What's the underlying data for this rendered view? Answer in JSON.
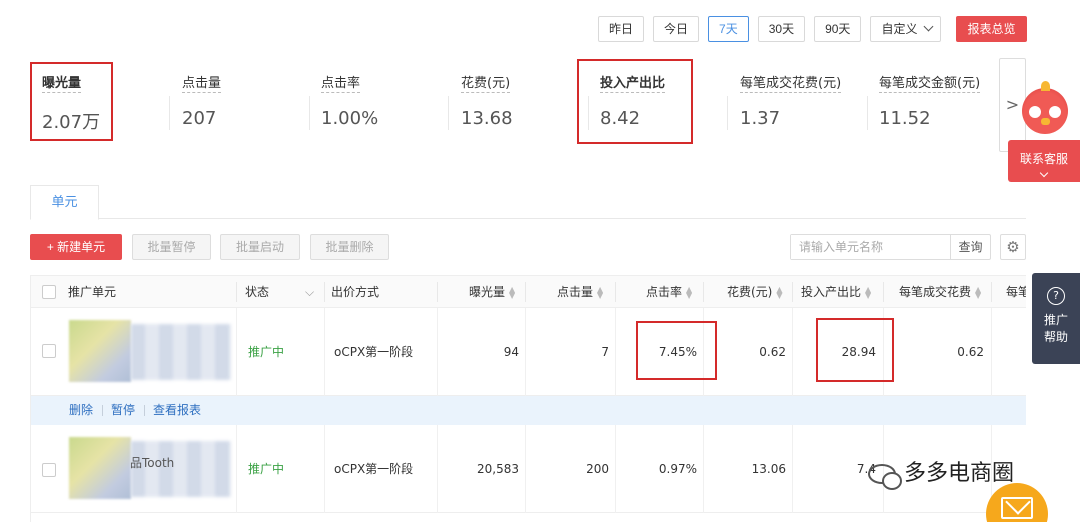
{
  "date_range": {
    "buttons": [
      "昨日",
      "今日",
      "7天",
      "30天",
      "90天"
    ],
    "active": "7天",
    "custom_label": "自定义",
    "summary_button": "报表总览"
  },
  "metrics": [
    {
      "label": "曝光量",
      "value": "2.07万"
    },
    {
      "label": "点击量",
      "value": "207"
    },
    {
      "label": "点击率",
      "value": "1.00%"
    },
    {
      "label": "花费(元)",
      "value": "13.68"
    },
    {
      "label": "投入产出比",
      "value": "8.42"
    },
    {
      "label": "每笔成交花费(元)",
      "value": "1.37"
    },
    {
      "label": "每笔成交金额(元)",
      "value": "11.52"
    }
  ],
  "metrics_next": ">",
  "service": {
    "label": "联系客服"
  },
  "tabs": [
    {
      "label": "单元"
    }
  ],
  "toolbar": {
    "new_unit": "+ 新建单元",
    "batch_pause": "批量暂停",
    "batch_start": "批量启动",
    "batch_delete": "批量删除",
    "search_placeholder": "请输入单元名称",
    "search_button": "查询"
  },
  "table": {
    "headers": {
      "unit": "推广单元",
      "status": "状态",
      "bid": "出价方式",
      "impressions": "曝光量",
      "clicks": "点击量",
      "ctr": "点击率",
      "cost": "花费(元)",
      "roi": "投入产出比",
      "cpo": "每笔成交花费",
      "cut": "每笔"
    },
    "rows": [
      {
        "status": "推广中",
        "bid": "oCPX第一阶段",
        "impressions": "94",
        "clicks": "7",
        "ctr": "7.45%",
        "cost": "0.62",
        "roi": "28.94",
        "cpo": "0.62"
      },
      {
        "status": "推广中",
        "bid": "oCPX第一阶段",
        "impressions": "20,583",
        "clicks": "200",
        "ctr": "0.97%",
        "cost": "13.06",
        "roi": "7.4",
        "cpo": "",
        "name_partial": "品Tooth"
      }
    ],
    "actions": [
      "删除",
      "暂停",
      "查看报表"
    ]
  },
  "help": {
    "line1": "推广",
    "line2": "帮助"
  },
  "watermark": {
    "text": "多多电商圈"
  }
}
